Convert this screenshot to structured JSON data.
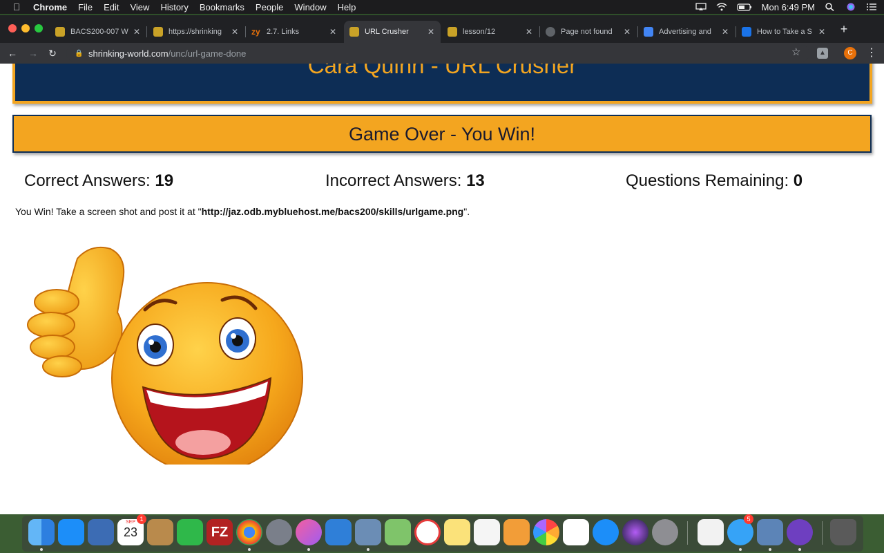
{
  "menubar": {
    "app_name": "Chrome",
    "menus": [
      "File",
      "Edit",
      "View",
      "History",
      "Bookmarks",
      "People",
      "Window",
      "Help"
    ],
    "clock": "Mon 6:49 PM"
  },
  "tabs": [
    {
      "title": "BACS200-007 W",
      "active": false
    },
    {
      "title": "https://shrinking",
      "active": false
    },
    {
      "title": "2.7. Links",
      "active": false
    },
    {
      "title": "URL Crusher",
      "active": true
    },
    {
      "title": "lesson/12",
      "active": false
    },
    {
      "title": "Page not found",
      "active": false
    },
    {
      "title": "Advertising and",
      "active": false
    },
    {
      "title": "How to Take a S",
      "active": false
    }
  ],
  "omnibox": {
    "domain": "shrinking-world.com",
    "path": "/unc/url-game-done"
  },
  "profile_initial": "C",
  "page": {
    "header_title": "Cara Quinn - URL Crusher",
    "status_title": "Game Over - You Win!",
    "scores": [
      {
        "label": "Correct Answers:",
        "value": "19"
      },
      {
        "label": "Incorrect Answers:",
        "value": "13"
      },
      {
        "label": "Questions Remaining:",
        "value": "0"
      }
    ],
    "message_prefix": "You Win! Take a screen shot and post it at \"",
    "message_url": "http://jaz.odb.mybluehost.me/bacs200/skills/urlgame.png",
    "message_suffix": "\".",
    "image_icon": "thumbs-up-smiley"
  },
  "dock": {
    "calendar_month": "SEP",
    "calendar_day": "23",
    "calendar_badge": "1",
    "messages_badge": "5"
  },
  "colors": {
    "navy": "#0d2d55",
    "gold": "#f3a520",
    "chrome_dark": "#202124",
    "chrome_toolbar": "#35363a"
  }
}
